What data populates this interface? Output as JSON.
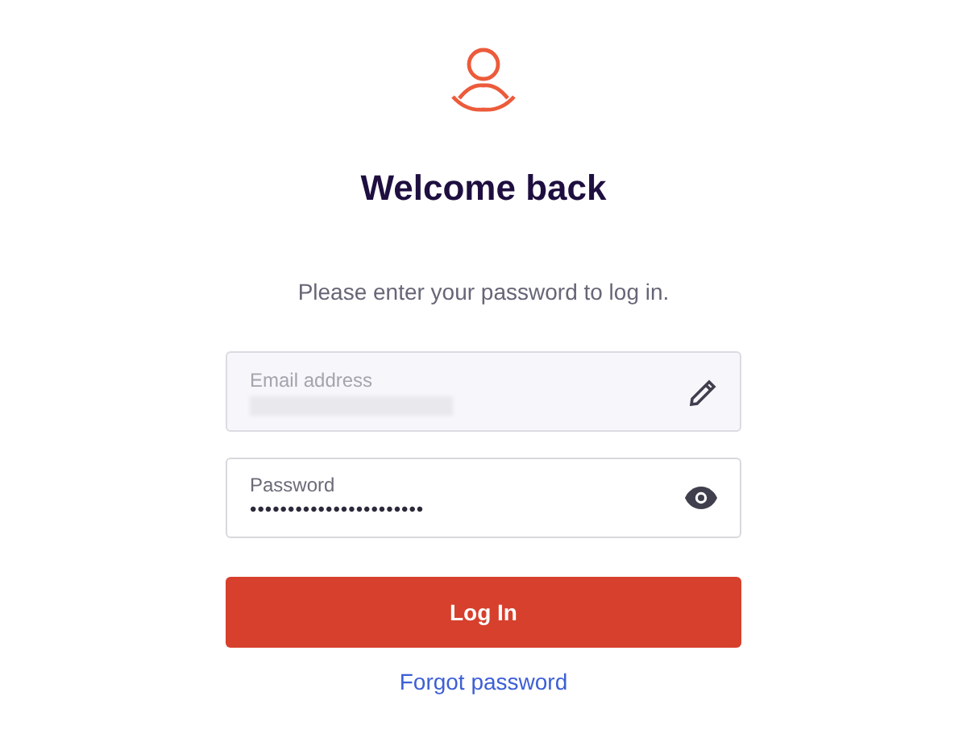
{
  "title": "Welcome back",
  "subtitle": "Please enter your password to log in.",
  "fields": [
    {
      "kind": "email",
      "label": "Email address",
      "disabled": true,
      "redacted": true
    },
    {
      "kind": "password",
      "label": "Password",
      "value": "•••••••••••••••••••••••",
      "disabled": false
    }
  ],
  "button": "Log In",
  "link": "Forgot password"
}
